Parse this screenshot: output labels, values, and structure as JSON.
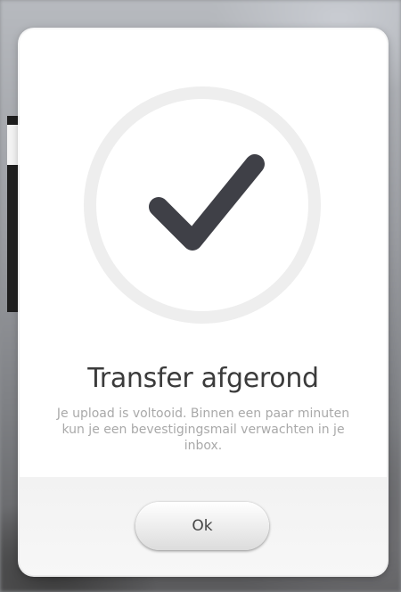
{
  "dialog": {
    "icon": "checkmark-icon",
    "title": "Transfer afgerond",
    "message": "Je upload is voltooid. Binnen een paar minuten kun je een bevestigingsmail verwachten in je inbox.",
    "ok_label": "Ok"
  },
  "colors": {
    "check": "#3f4047",
    "ring": "#eeeeee",
    "title_text": "#3b3b3b",
    "message_text": "#a9a9a9"
  }
}
